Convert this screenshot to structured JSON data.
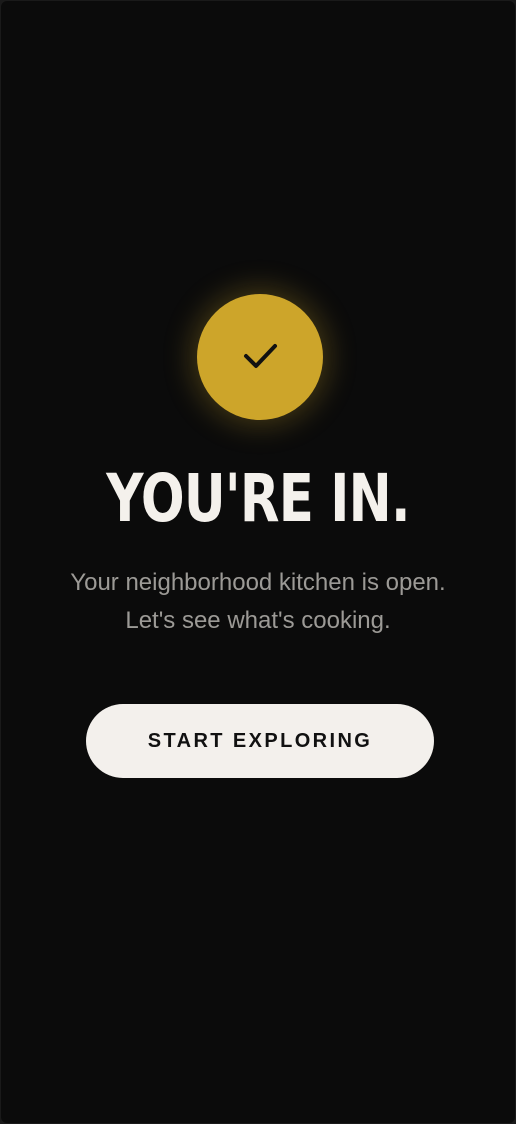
{
  "confirmation": {
    "icon": "check-icon",
    "accent_color": "#cda52a"
  },
  "headline": "YOU'RE IN.",
  "subtitle": "Your neighborhood kitchen is open. Let's see what's cooking.",
  "cta": {
    "label": "START EXPLORING"
  }
}
